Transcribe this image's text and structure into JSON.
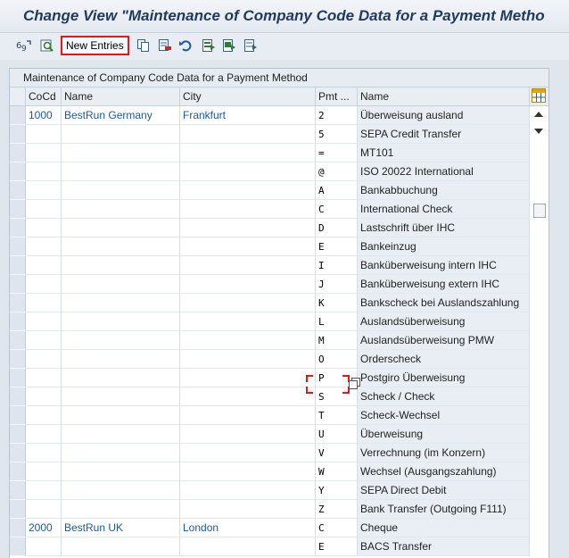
{
  "title": "Change View \"Maintenance of Company Code Data for a Payment Metho",
  "toolbar": {
    "new_entries_label": "New Entries",
    "icons": [
      "display-change-icon",
      "other-view-icon",
      "copy-icon",
      "delete-icon",
      "undo-icon",
      "select-all-icon",
      "select-block-icon",
      "deselect-all-icon"
    ]
  },
  "table": {
    "caption": "Maintenance of Company Code Data for a Payment Method",
    "columns": {
      "cocd": "CoCd",
      "name": "Name",
      "city": "City",
      "pmt": "Pmt ...",
      "pname": "Name"
    },
    "rows": [
      {
        "cocd": "1000",
        "name": "BestRun Germany",
        "city": "Frankfurt",
        "pmt": "2",
        "pname": "Überweisung ausland"
      },
      {
        "cocd": "",
        "name": "",
        "city": "",
        "pmt": "5",
        "pname": "SEPA Credit Transfer"
      },
      {
        "cocd": "",
        "name": "",
        "city": "",
        "pmt": "=",
        "pname": "MT101"
      },
      {
        "cocd": "",
        "name": "",
        "city": "",
        "pmt": "@",
        "pname": "ISO 20022 International"
      },
      {
        "cocd": "",
        "name": "",
        "city": "",
        "pmt": "A",
        "pname": "Bankabbuchung"
      },
      {
        "cocd": "",
        "name": "",
        "city": "",
        "pmt": "C",
        "pname": "International Check"
      },
      {
        "cocd": "",
        "name": "",
        "city": "",
        "pmt": "D",
        "pname": "Lastschrift über IHC"
      },
      {
        "cocd": "",
        "name": "",
        "city": "",
        "pmt": "E",
        "pname": "Bankeinzug"
      },
      {
        "cocd": "",
        "name": "",
        "city": "",
        "pmt": "I",
        "pname": "Banküberweisung intern IHC"
      },
      {
        "cocd": "",
        "name": "",
        "city": "",
        "pmt": "J",
        "pname": "Banküberweisung extern IHC"
      },
      {
        "cocd": "",
        "name": "",
        "city": "",
        "pmt": "K",
        "pname": "Bankscheck bei Auslandszahlung"
      },
      {
        "cocd": "",
        "name": "",
        "city": "",
        "pmt": "L",
        "pname": "Auslandsüberweisung"
      },
      {
        "cocd": "",
        "name": "",
        "city": "",
        "pmt": "M",
        "pname": "Auslandsüberweisung PMW"
      },
      {
        "cocd": "",
        "name": "",
        "city": "",
        "pmt": "O",
        "pname": "Orderscheck"
      },
      {
        "cocd": "",
        "name": "",
        "city": "",
        "pmt": "P",
        "pname": "Postgiro Überweisung"
      },
      {
        "cocd": "",
        "name": "",
        "city": "",
        "pmt": "S",
        "pname": "Scheck / Check"
      },
      {
        "cocd": "",
        "name": "",
        "city": "",
        "pmt": "T",
        "pname": "Scheck-Wechsel"
      },
      {
        "cocd": "",
        "name": "",
        "city": "",
        "pmt": "U",
        "pname": "Überweisung"
      },
      {
        "cocd": "",
        "name": "",
        "city": "",
        "pmt": "V",
        "pname": "Verrechnung (im Konzern)"
      },
      {
        "cocd": "",
        "name": "",
        "city": "",
        "pmt": "W",
        "pname": "Wechsel (Ausgangszahlung)"
      },
      {
        "cocd": "",
        "name": "",
        "city": "",
        "pmt": "Y",
        "pname": "SEPA Direct Debit"
      },
      {
        "cocd": "",
        "name": "",
        "city": "",
        "pmt": "Z",
        "pname": "Bank Transfer (Outgoing F111)"
      },
      {
        "cocd": "2000",
        "name": "BestRun UK",
        "city": "London",
        "pmt": "C",
        "pname": "Cheque"
      },
      {
        "cocd": "",
        "name": "",
        "city": "",
        "pmt": "E",
        "pname": "BACS Transfer"
      }
    ]
  },
  "colors": {
    "link_blue": "#1a59a8",
    "highlight_red": "#e01a1a",
    "title_blue": "#1f3a5a"
  }
}
